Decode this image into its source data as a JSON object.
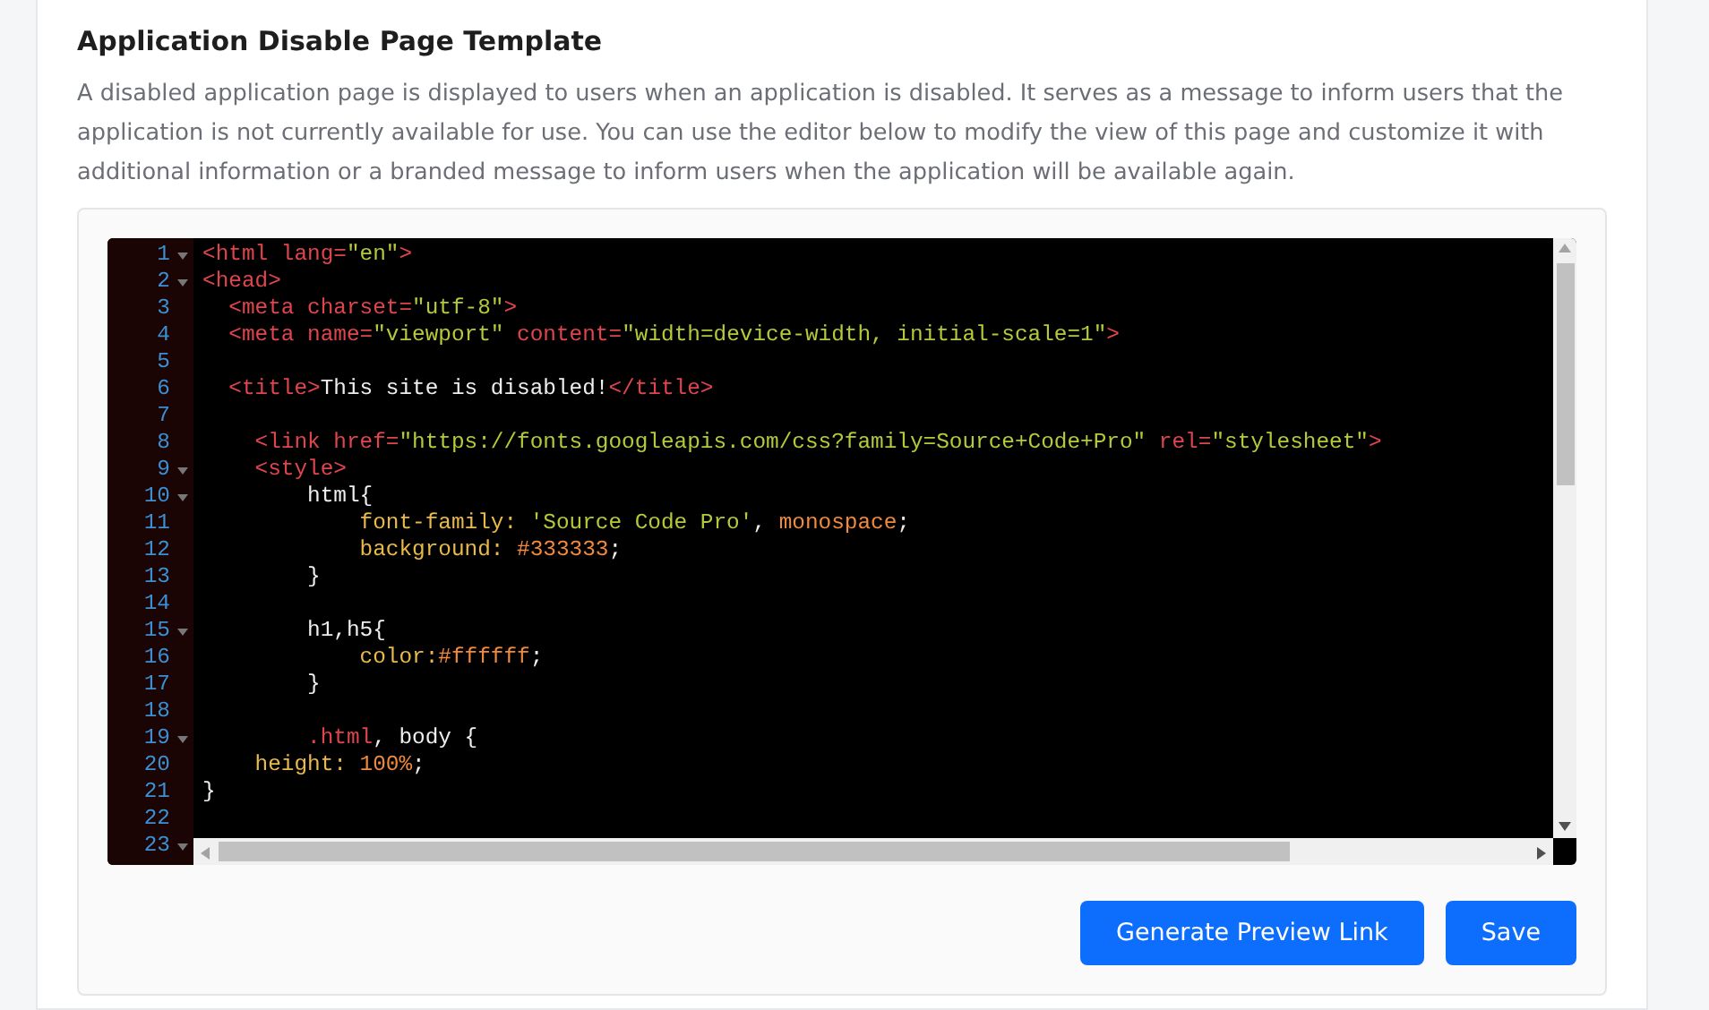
{
  "section": {
    "title": "Application Disable Page Template",
    "description": "A disabled application page is displayed to users when an application is disabled. It serves as a message to inform users that the application is not currently available for use. You can use the editor below to modify the view of this page and customize it with additional information or a branded message to inform users when the application will be available again."
  },
  "editor": {
    "lines": [
      {
        "number": "1",
        "fold": true,
        "tokens": [
          {
            "kind": "tag",
            "text": "<html "
          },
          {
            "kind": "attr",
            "text": "lang="
          },
          {
            "kind": "str",
            "text": "\"en\""
          },
          {
            "kind": "tag",
            "text": ">"
          }
        ]
      },
      {
        "number": "2",
        "fold": true,
        "tokens": [
          {
            "kind": "tag",
            "text": "<head>"
          }
        ]
      },
      {
        "number": "3",
        "fold": false,
        "tokens": [
          {
            "kind": "tag",
            "text": "  <meta "
          },
          {
            "kind": "attr",
            "text": "charset="
          },
          {
            "kind": "str",
            "text": "\"utf-8\""
          },
          {
            "kind": "tag",
            "text": ">"
          }
        ]
      },
      {
        "number": "4",
        "fold": false,
        "tokens": [
          {
            "kind": "tag",
            "text": "  <meta "
          },
          {
            "kind": "attr",
            "text": "name="
          },
          {
            "kind": "str",
            "text": "\"viewport\" "
          },
          {
            "kind": "attr",
            "text": "content="
          },
          {
            "kind": "str",
            "text": "\"width=device-width, initial-scale=1\""
          },
          {
            "kind": "tag",
            "text": ">"
          }
        ]
      },
      {
        "number": "5",
        "fold": false
      },
      {
        "number": "6",
        "fold": false,
        "tokens": [
          {
            "kind": "tag",
            "text": "  <title>"
          },
          {
            "kind": "text",
            "text": "This site is disabled!"
          },
          {
            "kind": "tag",
            "text": "</title>"
          }
        ]
      },
      {
        "number": "7",
        "fold": false
      },
      {
        "number": "8",
        "fold": false,
        "tokens": [
          {
            "kind": "tag",
            "text": "    <link "
          },
          {
            "kind": "attr",
            "text": "href="
          },
          {
            "kind": "str",
            "text": "\"https://fonts.googleapis.com/css?family=Source+Code+Pro\" "
          },
          {
            "kind": "attr",
            "text": "rel="
          },
          {
            "kind": "str",
            "text": "\"stylesheet\""
          },
          {
            "kind": "tag",
            "text": ">"
          }
        ]
      },
      {
        "number": "9",
        "fold": true,
        "tokens": [
          {
            "kind": "tag",
            "text": "    <style>"
          }
        ]
      },
      {
        "number": "10",
        "fold": true,
        "tokens": [
          {
            "kind": "text",
            "text": "        html{"
          }
        ]
      },
      {
        "number": "11",
        "fold": false,
        "tokens": [
          {
            "kind": "prop",
            "text": "            font-family: "
          },
          {
            "kind": "str",
            "text": "'Source Code Pro'"
          },
          {
            "kind": "text",
            "text": ", "
          },
          {
            "kind": "val",
            "text": "monospace"
          },
          {
            "kind": "text",
            "text": ";"
          }
        ]
      },
      {
        "number": "12",
        "fold": false,
        "tokens": [
          {
            "kind": "prop",
            "text": "            background: "
          },
          {
            "kind": "val",
            "text": "#333333"
          },
          {
            "kind": "text",
            "text": ";"
          }
        ]
      },
      {
        "number": "13",
        "fold": false,
        "tokens": [
          {
            "kind": "text",
            "text": "        }"
          }
        ]
      },
      {
        "number": "14",
        "fold": false
      },
      {
        "number": "15",
        "fold": true,
        "tokens": [
          {
            "kind": "text",
            "text": "        h1,h5{"
          }
        ]
      },
      {
        "number": "16",
        "fold": false,
        "tokens": [
          {
            "kind": "prop",
            "text": "            color:"
          },
          {
            "kind": "val",
            "text": "#ffffff"
          },
          {
            "kind": "text",
            "text": ";"
          }
        ]
      },
      {
        "number": "17",
        "fold": false,
        "tokens": [
          {
            "kind": "text",
            "text": "        }"
          }
        ]
      },
      {
        "number": "18",
        "fold": false
      },
      {
        "number": "19",
        "fold": true,
        "tokens": [
          {
            "kind": "tag",
            "text": "        .html"
          },
          {
            "kind": "text",
            "text": ", body {"
          }
        ]
      },
      {
        "number": "20",
        "fold": false,
        "tokens": [
          {
            "kind": "prop",
            "text": "    height: "
          },
          {
            "kind": "val",
            "text": "100%"
          },
          {
            "kind": "text",
            "text": ";"
          }
        ]
      },
      {
        "number": "21",
        "fold": false,
        "tokens": [
          {
            "kind": "text",
            "text": "}"
          }
        ]
      },
      {
        "number": "22",
        "fold": false
      },
      {
        "number": "23",
        "fold": true
      }
    ]
  },
  "buttons": [
    {
      "label": "Generate Preview Link"
    },
    {
      "label": "Save"
    }
  ]
}
